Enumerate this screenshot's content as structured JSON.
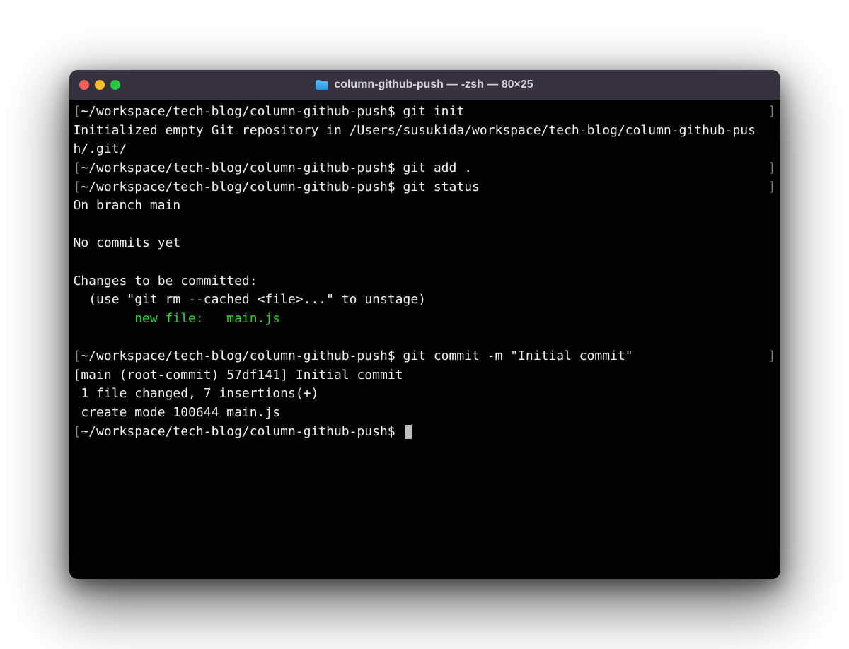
{
  "window": {
    "title": "column-github-push — -zsh — 80×25"
  },
  "prompt": {
    "path": "~/workspace/tech-blog/column-github-push",
    "symbol": "$"
  },
  "lines": [
    {
      "type": "cmd",
      "text": "git init"
    },
    {
      "type": "out",
      "text": "Initialized empty Git repository in /Users/susukida/workspace/tech-blog/column-github-push/.git/"
    },
    {
      "type": "cmd",
      "text": "git add ."
    },
    {
      "type": "cmd",
      "text": "git status"
    },
    {
      "type": "out",
      "text": "On branch main"
    },
    {
      "type": "blank",
      "text": ""
    },
    {
      "type": "out",
      "text": "No commits yet"
    },
    {
      "type": "blank",
      "text": ""
    },
    {
      "type": "out",
      "text": "Changes to be committed:"
    },
    {
      "type": "out",
      "text": "  (use \"git rm --cached <file>...\" to unstage)"
    },
    {
      "type": "green",
      "text": "        new file:   main.js"
    },
    {
      "type": "blank",
      "text": ""
    },
    {
      "type": "cmd",
      "text": "git commit -m \"Initial commit\""
    },
    {
      "type": "out",
      "text": "[main (root-commit) 57df141] Initial commit"
    },
    {
      "type": "out",
      "text": " 1 file changed, 7 insertions(+)"
    },
    {
      "type": "out",
      "text": " create mode 100644 main.js"
    },
    {
      "type": "cursor",
      "text": ""
    }
  ]
}
